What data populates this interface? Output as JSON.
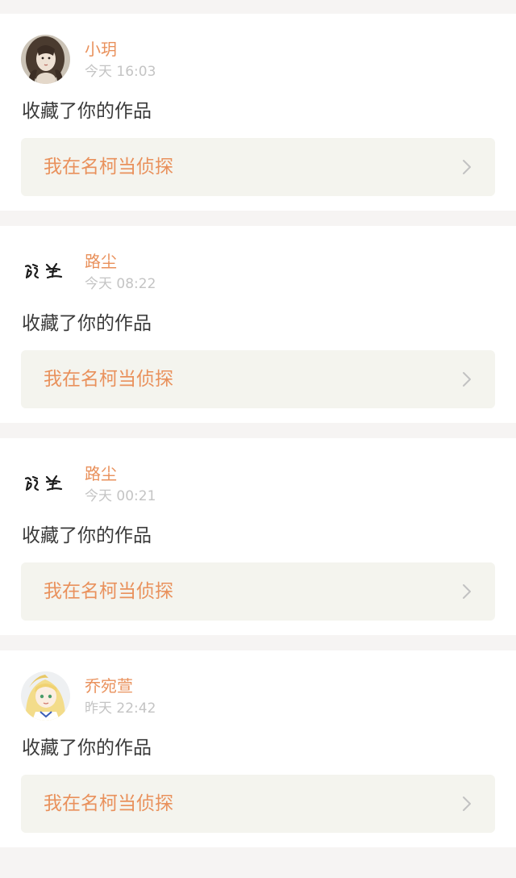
{
  "notifications": [
    {
      "user": "小玥",
      "time": "今天 16:03",
      "action": "收藏了你的作品",
      "work_title": "我在名柯当侦探",
      "avatar_icon": "portrait-avatar-icon"
    },
    {
      "user": "路尘",
      "time": "今天 08:22",
      "action": "收藏了你的作品",
      "work_title": "我在名柯当侦探",
      "avatar_icon": "calligraphy-avatar-icon"
    },
    {
      "user": "路尘",
      "time": "今天 00:21",
      "action": "收藏了你的作品",
      "work_title": "我在名柯当侦探",
      "avatar_icon": "calligraphy-avatar-icon"
    },
    {
      "user": "乔宛萱",
      "time": "昨天 22:42",
      "action": "收藏了你的作品",
      "work_title": "我在名柯当侦探",
      "avatar_icon": "anime-avatar-icon"
    }
  ],
  "colors": {
    "accent": "#e9915c",
    "time": "#c4c4c4",
    "text": "#3a3a3a",
    "link_bg": "#f4f4ee",
    "page_bg": "#f6f4f3"
  },
  "icons": {
    "chevron": "chevron-right-icon"
  }
}
